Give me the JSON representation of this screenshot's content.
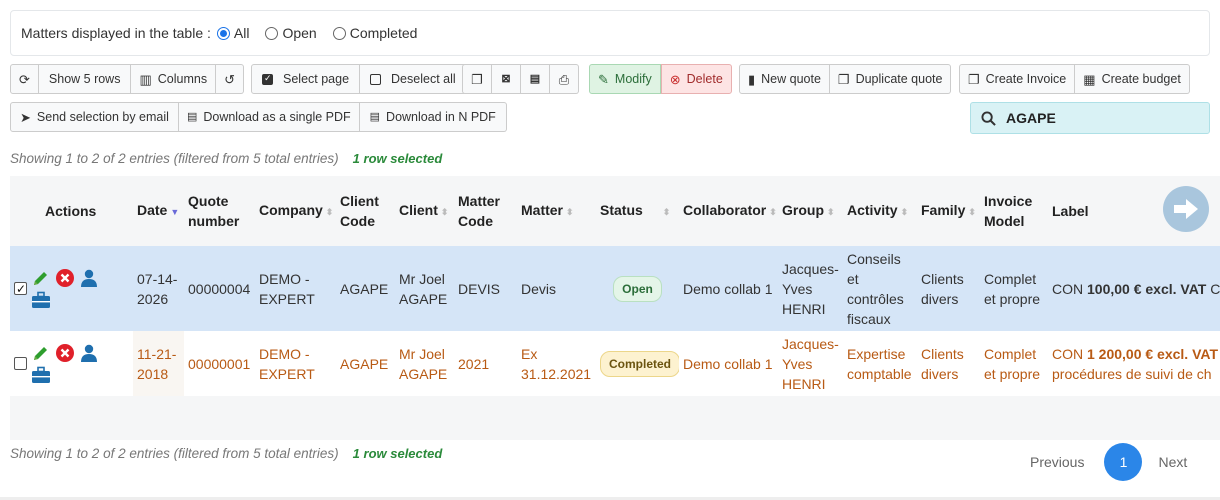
{
  "filter": {
    "label": "Matters displayed in the table :",
    "options": [
      "All",
      "Open",
      "Completed"
    ],
    "selected": "All"
  },
  "toolbar": {
    "refresh_title": "",
    "show_rows": "Show 5 rows",
    "columns": "Columns",
    "select_page": "Select page",
    "deselect_all": "Deselect all",
    "modify": "Modify",
    "delete": "Delete",
    "new_quote": "New quote",
    "duplicate_quote": "Duplicate quote",
    "create_invoice": "Create Invoice",
    "create_budget": "Create budget",
    "send_email": "Send selection by email",
    "download_single_pdf": "Download as a single PDF",
    "download_n_pdf": "Download in N PDF"
  },
  "search": {
    "value": "AGAPE"
  },
  "info": {
    "showing": "Showing 1 to 2 of 2 entries (filtered from 5 total entries)",
    "selected": "1 row selected"
  },
  "columns": [
    "Actions",
    "Date",
    "Quote number",
    "Company",
    "Client Code",
    "Client",
    "Matter Code",
    "Matter",
    "Status",
    "Collaborator",
    "Group",
    "Activity",
    "Family",
    "Invoice Model",
    "Label"
  ],
  "rows": [
    {
      "checked": true,
      "date": "07-14-2026",
      "quote_number": "00000004",
      "company": "DEMO - EXPERT",
      "client_code": "AGAPE",
      "client": "Mr Joel AGAPE",
      "matter_code": "DEVIS",
      "matter": "Devis",
      "status": "Open",
      "collaborator": "Demo collab 1",
      "group": "Jacques-Yves HENRI",
      "activity": "Conseils et contrôles fiscaux",
      "family": "Clients divers",
      "invoice_model": "Complet et propre",
      "label_prefix": "CON ",
      "label_amount": "100,00 € excl. VAT",
      "label_suffix": " C",
      "label_line2": ""
    },
    {
      "checked": false,
      "date": "11-21-2018",
      "quote_number": "00000001",
      "company": "DEMO - EXPERT",
      "client_code": "AGAPE",
      "client": "Mr Joel AGAPE",
      "matter_code": "2021",
      "matter": "Ex 31.12.2021",
      "status": "Completed",
      "collaborator": "Demo collab 1",
      "group": "Jacques-Yves HENRI",
      "activity": "Expertise comptable",
      "family": "Clients divers",
      "invoice_model": "Complet et propre",
      "label_prefix": "CON ",
      "label_amount": "1 200,00 € excl. VAT",
      "label_suffix": "",
      "label_line2": "procédures de suivi de ch"
    }
  ],
  "pager": {
    "previous": "Previous",
    "page": "1",
    "next": "Next"
  },
  "colors": {
    "accent": "#2b86e8",
    "selected_row": "#d5e5f7",
    "completed_text": "#b85a14"
  }
}
